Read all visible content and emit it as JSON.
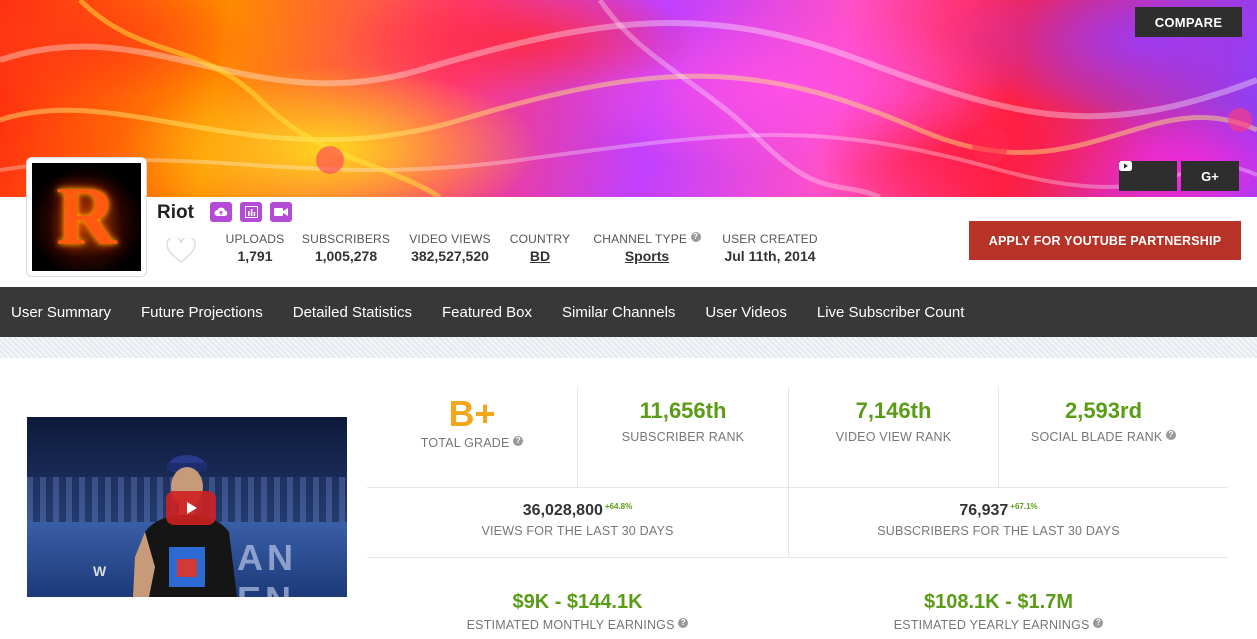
{
  "header": {
    "compare_label": "COMPARE",
    "youtube_icon": "youtube-icon",
    "gplus_label": "G+"
  },
  "channel": {
    "name": "Riot",
    "avatar_letter": "R",
    "badges": [
      "upload-cloud-icon",
      "bar-chart-icon",
      "video-camera-icon"
    ]
  },
  "stats": {
    "uploads_label": "UPLOADS",
    "uploads_value": "1,791",
    "subscribers_label": "SUBSCRIBERS",
    "subscribers_value": "1,005,278",
    "views_label": "VIDEO VIEWS",
    "views_value": "382,527,520",
    "country_label": "COUNTRY",
    "country_value": "BD",
    "type_label": "CHANNEL TYPE",
    "type_value": "Sports",
    "created_label": "USER CREATED",
    "created_value": "Jul 11th, 2014"
  },
  "apply_label": "APPLY FOR YOUTUBE PARTNERSHIP",
  "nav": {
    "items": [
      "User Summary",
      "Future Projections",
      "Detailed Statistics",
      "Featured Box",
      "Similar Channels",
      "User Videos",
      "Live Subscriber Count"
    ]
  },
  "video": {
    "stage_text": "AN EN",
    "brand_mark": "W"
  },
  "summary": {
    "grade": "B+",
    "grade_label": "TOTAL GRADE",
    "subscriber_rank": "11,656th",
    "subscriber_rank_label": "SUBSCRIBER RANK",
    "view_rank": "7,146th",
    "view_rank_label": "VIDEO VIEW RANK",
    "sb_rank": "2,593rd",
    "sb_rank_label": "SOCIAL BLADE RANK",
    "views_30": "36,028,800",
    "views_30_pct": "+64.8%",
    "views_30_label": "VIEWS FOR THE LAST 30 DAYS",
    "subs_30": "76,937",
    "subs_30_pct": "+67.1%",
    "subs_30_label": "SUBSCRIBERS FOR THE LAST 30 DAYS",
    "monthly": "$9K - $144.1K",
    "monthly_label": "ESTIMATED MONTHLY EARNINGS",
    "yearly": "$108.1K - $1.7M",
    "yearly_label": "ESTIMATED YEARLY EARNINGS"
  },
  "colors": {
    "accent_green": "#5a9c16",
    "grade_orange": "#f2a61c",
    "apply_red": "#b73328",
    "badge_purple": "#b34bd6",
    "nav_dark": "#383838"
  }
}
